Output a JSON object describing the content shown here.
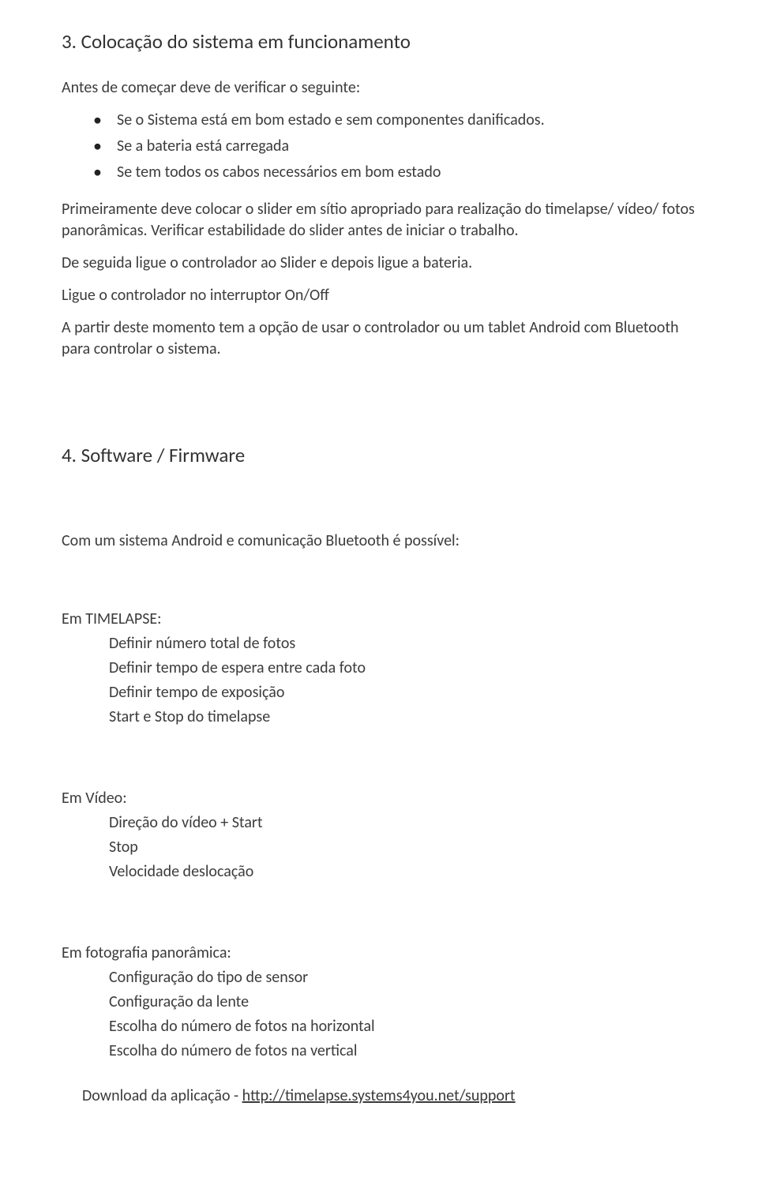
{
  "section3": {
    "title": "3.  Colocação do sistema em funcionamento",
    "intro": "Antes de começar deve de verificar o seguinte:",
    "bullets": [
      "Se o Sistema está em bom estado e sem componentes danificados.",
      "Se a bateria está carregada",
      "Se tem todos os cabos necessários em bom estado"
    ],
    "p1": "Primeiramente deve colocar o slider em sítio apropriado para realização do timelapse/ vídeo/ fotos panorâmicas. Verificar estabilidade do slider antes de iniciar o trabalho.",
    "p2": "De seguida ligue o controlador ao Slider e depois ligue a bateria.",
    "p3": "Ligue o controlador no interruptor On/Off",
    "p4": "A partir deste momento tem a opção de usar o controlador ou um tablet Android com Bluetooth para controlar o sistema."
  },
  "section4": {
    "title": "4.  Software / Firmware",
    "intro": "Com um sistema Android e comunicação Bluetooth é possível:",
    "timelapse": {
      "heading": "Em TIMELAPSE:",
      "items": [
        "Definir número total de fotos",
        "Definir tempo de espera entre cada foto",
        "Definir tempo de exposição",
        "Start e Stop do timelapse"
      ]
    },
    "video": {
      "heading": "Em Vídeo:",
      "items": [
        "Direção do vídeo + Start",
        "Stop",
        "Velocidade deslocação"
      ]
    },
    "panorama": {
      "heading": "Em fotografia panorâmica:",
      "items": [
        "Configuração do tipo de sensor",
        "Configuração da lente",
        "Escolha do número de fotos na horizontal",
        "Escolha do número de fotos na vertical"
      ]
    },
    "download_prefix": "Download da aplicação - ",
    "download_link": "http://timelapse.systems4you.net/support"
  }
}
